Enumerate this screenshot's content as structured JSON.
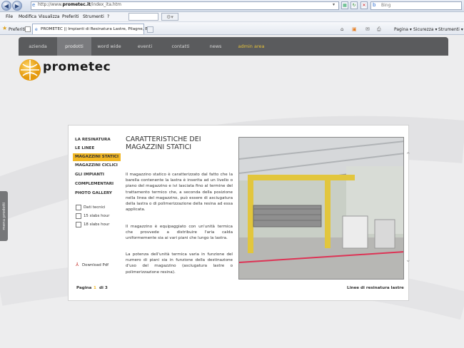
{
  "browser": {
    "url_prefix": "http://www.",
    "url_domain": "prometec.it",
    "url_path": "/index_ita.htm",
    "search_engine": "Bing",
    "menu": [
      "File",
      "Modifica",
      "Visualizza",
      "Preferiti",
      "Strumenti",
      "?"
    ],
    "favorites_label": "Preferiti",
    "tab_title": "PROMETEC || Impianti di Resinatura Lastre, Pilagne, B...",
    "commands": [
      "Pagina ▾",
      "Sicurezza ▾",
      "Strumenti ▾"
    ]
  },
  "site": {
    "nav": [
      "azienda",
      "prodotti",
      "word wide",
      "eventi",
      "contatti",
      "news",
      "admin area"
    ],
    "logo": "prometec",
    "side_menu": [
      "LA RESINATURA",
      "LE LINEE",
      "MAGAZZINI STATICI",
      "MAGAZZINI CICLICI",
      "GLI IMPIANTI",
      "COMPLEMENTARI",
      "PHOTO GALLERY"
    ],
    "checkboxes": [
      "Dati tecnici",
      "15 slabs hour",
      "18 slabs hour"
    ],
    "download": "Download Pdf",
    "pagination_label": "Pagina",
    "page_num": "1",
    "page_total": "di 3",
    "title": "CARATTERISTICHE DEI MAGAZZINI STATICI",
    "paragraphs": [
      "Il magazzino statico è caratterizzato dal fatto che la barella contenente la lastra è inserita ad un livello o piano del magazzino e ivi lasciata fino al termine del trattamento termico che, a seconda della posizione nella linea del magazzino, può essere di asciugatura della lastra o di polimerizzazione della resina ad essa applicata.",
      "Il magazzino è equipaggiato con un'unità termica che provvede a distribuire l'aria calda uniformemente sia ai vari piani che lungo la lastra.",
      "La potenza dell'unità termica varia in funzione del numero di piani sia in funzione della destinazione d'uso del magazzino (asciugatura lastre o polimerizzazione resina)."
    ],
    "caption": "Linee di resinatura lastre",
    "side_tab": "menu prodotti",
    "colors": {
      "nav_bar": "#5a5b5d",
      "highlight": "#f2b825",
      "admin_link": "#e6c23a"
    }
  }
}
